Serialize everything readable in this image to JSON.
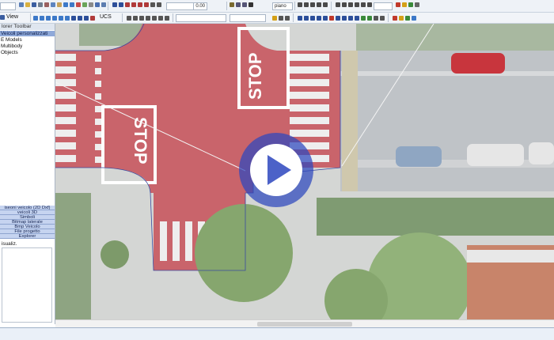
{
  "toolbar": {
    "view_label": "View",
    "ucs_label": "UCS",
    "value_field": "0.00",
    "plane_field": "piano"
  },
  "panel": {
    "title": "lorer Toolbar",
    "selected_item": "Veicoli personalizzati",
    "tree": [
      "E Models",
      "Multibody",
      "Objects"
    ],
    "buttons": [
      "iseoni veicolo (2D Dxf)",
      "veicoli 3D",
      "Simboli",
      "Bitmap laterale",
      "Bmp Veicolo",
      "File progetto",
      "Explorer"
    ],
    "visual_label": "isualiz."
  },
  "map": {
    "stop_text": "STOP",
    "road_color": "#c9646b",
    "asphalt_color": "#bfc3c7"
  },
  "player": {
    "icon": "play-icon",
    "accent": "#2d46be"
  }
}
